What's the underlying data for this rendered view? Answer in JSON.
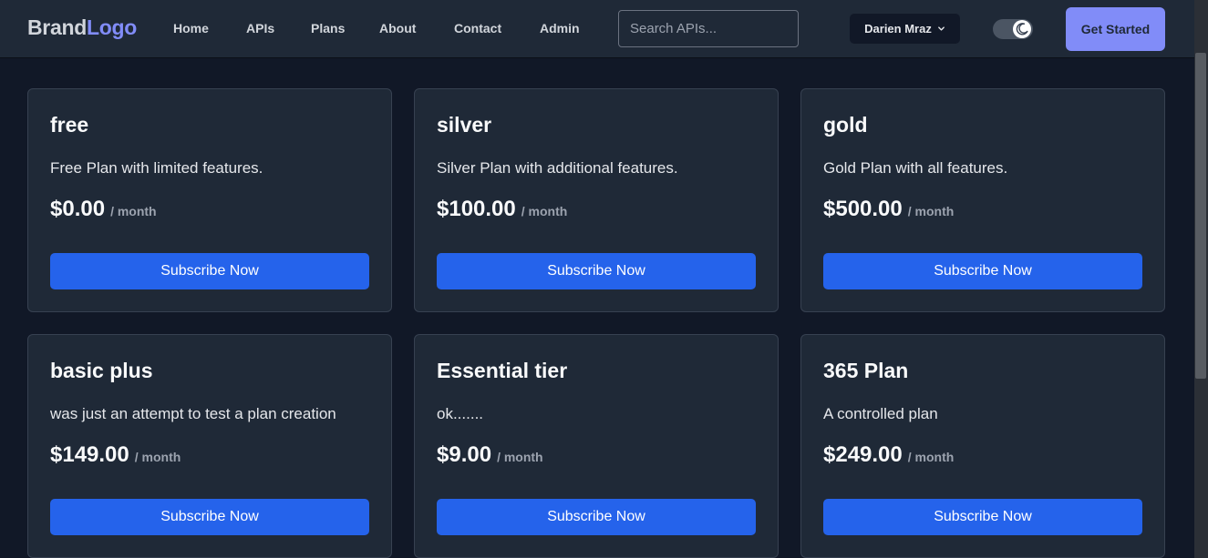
{
  "brand": {
    "part1": "Brand",
    "part2": "Logo"
  },
  "nav": {
    "links": [
      "Home",
      "APIs",
      "Plans",
      "About",
      "Contact",
      "Admin"
    ],
    "search_placeholder": "Search APIs...",
    "user_name": "Darien Mraz",
    "theme_toggle_icon": "moon-icon",
    "cta_label": "Get Started"
  },
  "plans": [
    {
      "name": "free",
      "description": "Free Plan with limited features.",
      "price": "$0.00",
      "period": "/ month",
      "button": "Subscribe Now"
    },
    {
      "name": "silver",
      "description": "Silver Plan with additional features.",
      "price": "$100.00",
      "period": "/ month",
      "button": "Subscribe Now"
    },
    {
      "name": "gold",
      "description": "Gold Plan with all features.",
      "price": "$500.00",
      "period": "/ month",
      "button": "Subscribe Now"
    },
    {
      "name": "basic plus",
      "description": "was just an attempt to test a plan creation",
      "price": "$149.00",
      "period": "/ month",
      "button": "Subscribe Now"
    },
    {
      "name": "Essential tier",
      "description": "ok.......",
      "price": "$9.00",
      "period": "/ month",
      "button": "Subscribe Now"
    },
    {
      "name": "365 Plan",
      "description": "A controlled plan",
      "price": "$249.00",
      "period": "/ month",
      "button": "Subscribe Now"
    }
  ],
  "colors": {
    "background": "#111827",
    "navbar": "#1f2937",
    "card": "#1f2937",
    "accent": "#818cf8",
    "button": "#2563eb"
  }
}
